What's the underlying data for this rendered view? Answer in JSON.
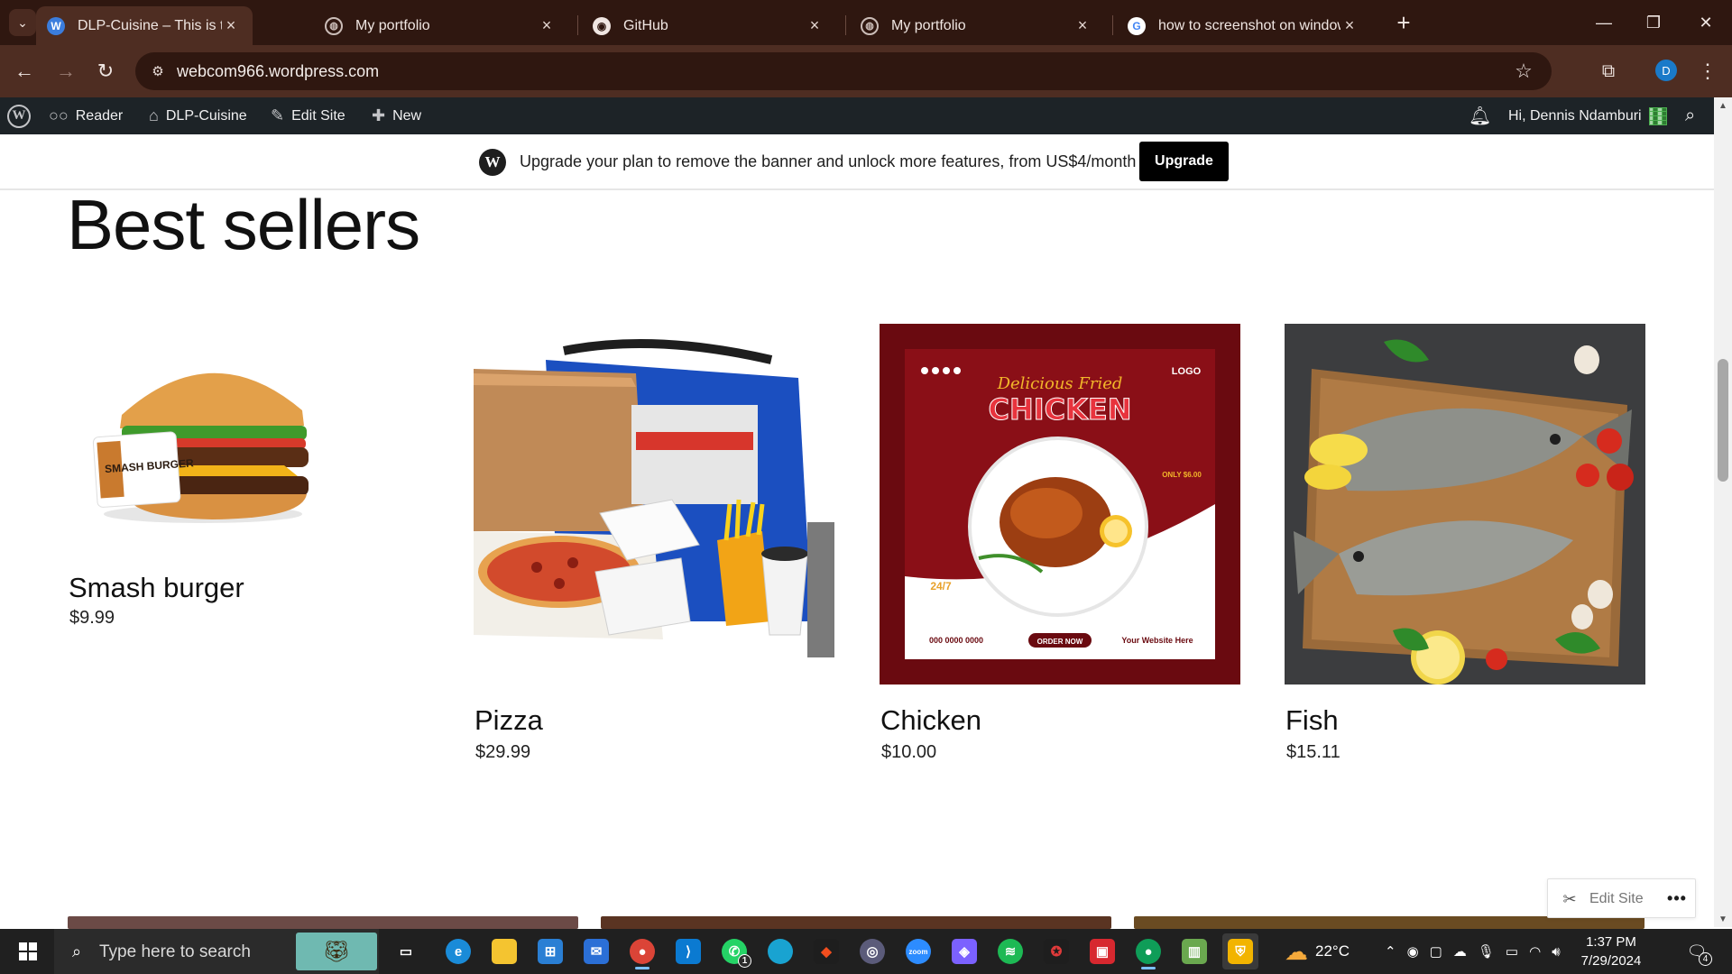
{
  "browser": {
    "tabs": [
      {
        "title": "DLP-Cuisine – This is the homep",
        "favicon": "wordpress-icon",
        "active": true
      },
      {
        "title": "My portfolio",
        "favicon": "globe-icon",
        "active": false
      },
      {
        "title": "GitHub",
        "favicon": "github-icon",
        "active": false
      },
      {
        "title": "My portfolio",
        "favicon": "globe-icon",
        "active": false
      },
      {
        "title": "how to screenshot on windows",
        "favicon": "google-icon",
        "active": false
      }
    ],
    "url": "webcom966.wordpress.com",
    "profile_initial": "D"
  },
  "admin_bar": {
    "reader": "Reader",
    "site_name": "DLP-Cuisine",
    "edit_site": "Edit Site",
    "new": "New",
    "greeting": "Hi, Dennis Ndamburi"
  },
  "banner": {
    "text": "Upgrade your plan to remove the banner and unlock more features, from US$4/month",
    "button": "Upgrade"
  },
  "page": {
    "title": "Best sellers",
    "products": [
      {
        "name": "Smash burger",
        "price": "$9.99",
        "image_label": "SMASH BURGER"
      },
      {
        "name": "Pizza",
        "price": "$29.99"
      },
      {
        "name": "Chicken",
        "price": "$10.00",
        "image_label": "CHICKEN",
        "image_script": "Delicious Fried",
        "image_logo": "LOGO",
        "image_order": "ORDER NOW",
        "image_phone": "000 0000 0000",
        "image_site": "Your Website Here",
        "image_price": "ONLY $6.00",
        "image_hours": "24/7"
      },
      {
        "name": "Fish",
        "price": "$15.11"
      }
    ]
  },
  "floating": {
    "edit_site": "Edit Site"
  },
  "taskbar": {
    "search_placeholder": "Type here to search",
    "temperature": "22°C",
    "time": "1:37 PM",
    "date": "7/29/2024",
    "whatsapp_badge": "1",
    "notification_count": "4"
  },
  "colors": {
    "tab_strip": "#2f1710",
    "toolbar": "#4e2d22",
    "admin_bar": "#1d2327",
    "accent": "#000000"
  }
}
